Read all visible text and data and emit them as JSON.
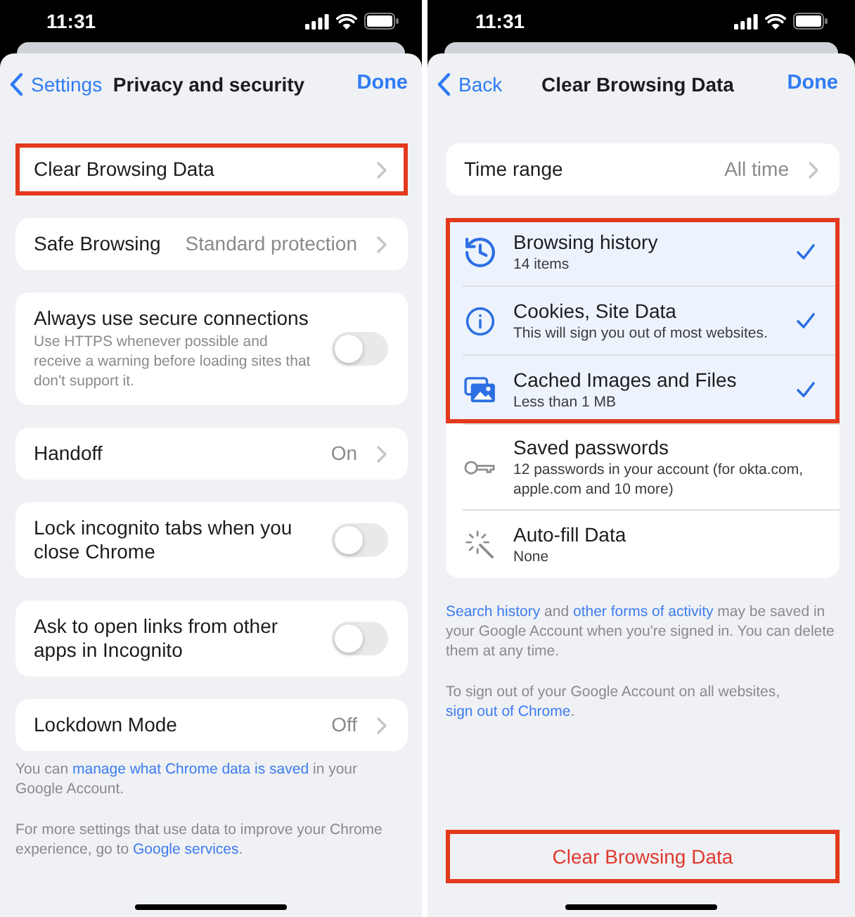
{
  "screens": [
    {
      "status_bar": {
        "time": "11:31"
      },
      "nav": {
        "back": "Settings",
        "title": "Privacy and security",
        "done": "Done"
      },
      "cards": [
        {
          "rows": [
            {
              "kind": "link",
              "title": "Clear Browsing Data",
              "highlighted": true
            }
          ]
        },
        {
          "rows": [
            {
              "kind": "link",
              "title": "Safe Browsing",
              "value": "Standard protection",
              "highlighted": false
            }
          ]
        },
        {
          "rows": [
            {
              "kind": "toggle",
              "title": "Always use secure connections",
              "description": "Use HTTPS whenever possible and receive a warning before loading sites that don't support it.",
              "on": false,
              "highlighted": false
            }
          ]
        },
        {
          "rows": [
            {
              "kind": "link",
              "title": "Handoff",
              "value": "On",
              "highlighted": false
            }
          ]
        },
        {
          "rows": [
            {
              "kind": "toggle",
              "title": "Lock incognito tabs when you close Chrome",
              "on": false,
              "highlighted": false
            }
          ]
        },
        {
          "rows": [
            {
              "kind": "toggle",
              "title": "Ask to open links from other apps in Incognito",
              "on": false,
              "highlighted": false
            }
          ]
        },
        {
          "rows": [
            {
              "kind": "link",
              "title": "Lockdown Mode",
              "value": "Off",
              "highlighted": false
            }
          ]
        }
      ],
      "footer": [
        [
          {
            "text": "You can ",
            "link": false
          },
          {
            "text": "manage what Chrome data is saved",
            "link": true
          },
          {
            "text": " in your Google Account.",
            "link": false
          }
        ],
        [
          {
            "text": "For more settings that use data to improve your Chrome experience, go to ",
            "link": false
          },
          {
            "text": "Google services",
            "link": true
          },
          {
            "text": ".",
            "link": false
          }
        ]
      ]
    },
    {
      "status_bar": {
        "time": "11:31"
      },
      "nav": {
        "back": "Back",
        "title": "Clear Browsing Data",
        "done": "Done"
      },
      "cards": [
        {
          "rows": [
            {
              "kind": "link",
              "title": "Time range",
              "value": "All time",
              "highlighted": false
            }
          ]
        },
        {
          "rows": [
            {
              "kind": "check",
              "title": "Browsing history",
              "subtitle": "14 items",
              "checked": true,
              "highlighted": true
            },
            {
              "kind": "check",
              "title": "Cookies, Site Data",
              "subtitle": "This will sign you out of most websites.",
              "checked": true,
              "highlighted": true
            },
            {
              "kind": "check",
              "title": "Cached Images and Files",
              "subtitle": "Less than 1 MB",
              "checked": true,
              "highlighted": true
            },
            {
              "kind": "check",
              "title": "Saved passwords",
              "subtitle": "12 passwords in your account (for okta.com, apple.com and 10 more)",
              "checked": false,
              "highlighted": false
            },
            {
              "kind": "check",
              "title": "Auto-fill Data",
              "subtitle": "None",
              "checked": false,
              "highlighted": false
            }
          ]
        }
      ],
      "footer": [
        [
          {
            "text": "Search history",
            "link": true
          },
          {
            "text": " and ",
            "link": false
          },
          {
            "text": "other forms of activity",
            "link": true
          },
          {
            "text": " may be saved in your Google Account when you're signed in. You can delete them at any time.",
            "link": false
          }
        ],
        [
          {
            "text": "To sign out of your Google Account on all websites, ",
            "link": false
          },
          {
            "text": "sign out of Chrome",
            "link": true
          },
          {
            "text": ".",
            "link": false
          }
        ]
      ],
      "action_button": {
        "label": "Clear Browsing Data",
        "highlighted": true
      }
    }
  ]
}
